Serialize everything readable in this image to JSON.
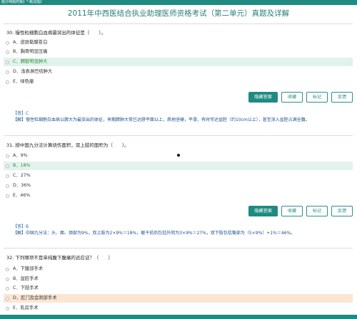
{
  "header": {
    "breadcrumb": "题分纯题附赛】*·概试题】",
    "title": "2011年中西医结合执业助理医师资格考试（第二单元）真题及详解"
  },
  "buttons": {
    "hide_answer": "隐藏答案",
    "favorite": "收藏",
    "mark": "标记",
    "feedback": "反馈"
  },
  "questions": [
    {
      "text": "30. 慢性粒细胞白血病最突出的体征是（　　）。",
      "options": [
        {
          "label": "A．皮肤黏膜苍白"
        },
        {
          "label": "B．胸骨明显压痛"
        },
        {
          "label": "C．脾脏明显肿大"
        },
        {
          "label": "D．浅表淋巴结肿大"
        },
        {
          "label": "E．绿色瘤"
        }
      ],
      "answer": "【答】C",
      "explanation": "【解】慢性粒细胞白血病以脾大为最突出的体征，早期脾肿大常已达脐平面以上，质地坚硬，平滑，有时可达盆腔（约10cm以上），甚至深入盆腔占满全腹。"
    },
    {
      "text": "31. 按中国九分法计算烧伤面积，双上肢的面积为（　　）。",
      "options": [
        {
          "label": "A．9%"
        },
        {
          "label": "B．18%"
        },
        {
          "label": "C．27%"
        },
        {
          "label": "D．36%"
        },
        {
          "label": "E．46%"
        }
      ],
      "answer": "【答】B",
      "explanation": "【解】中国九分法：头、面、颈部为9%，双上肢为2×9%＝18%，躯干前后包括外阴为3×9%＝27%，双下肢包括臀部为（5×9%）+1%＝46%。"
    },
    {
      "text": "32. 下列哪项不是单纯腹下腹痛的适应证？（　　）",
      "options": [
        {
          "label": "A．下腹部手术"
        },
        {
          "label": "B．盆腔手术"
        },
        {
          "label": "C．下肢手术"
        },
        {
          "label": "D．肛门及会阴部手术"
        },
        {
          "label": "E．乳房手术"
        }
      ]
    }
  ],
  "colors": {
    "brand": "#1f8a80",
    "selected_bg": "#e2f2ec",
    "selected_text": "#2a8f3a",
    "highlight_orange": "#fbe6d4",
    "answer_blue": "#1b4f8c"
  }
}
